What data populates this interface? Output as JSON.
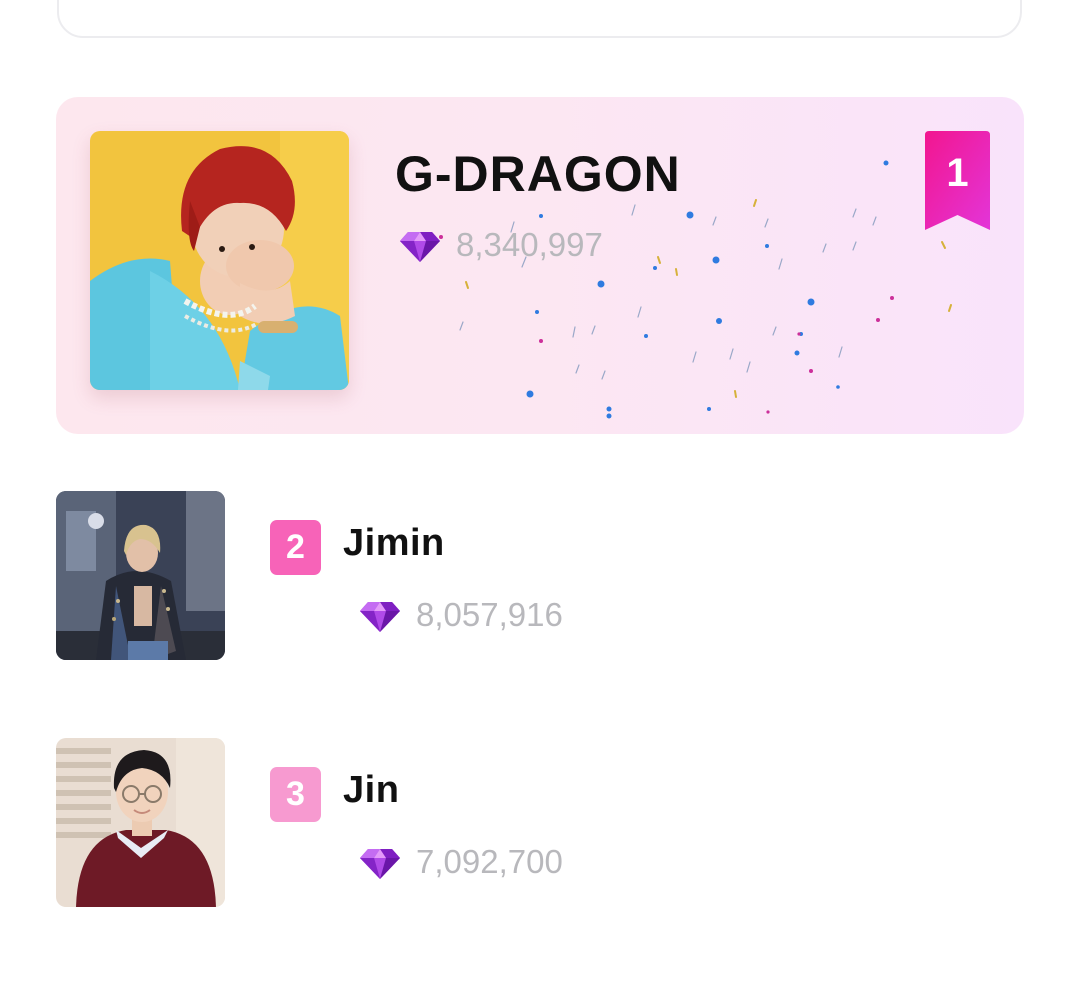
{
  "leaderboard": {
    "first": {
      "rank": "1",
      "name": "G-DRAGON",
      "votes": "8,340,997",
      "photo_icon": "artist-photo",
      "ribbon_color": "#ee22b0"
    },
    "others": [
      {
        "rank": "2",
        "name": "Jimin",
        "votes": "8,057,916",
        "badge_color": "#f763b8"
      },
      {
        "rank": "3",
        "name": "Jin",
        "votes": "7,092,700",
        "badge_color": "#f79ad0"
      }
    ]
  },
  "icons": {
    "vote": "diamond-gem-icon",
    "rank": "ribbon-bookmark-icon"
  },
  "colors": {
    "hero_bg_start": "#fde7ee",
    "hero_bg_end": "#f9e3fb",
    "votes_text": "#b8b8bc",
    "name_text": "#111111"
  }
}
